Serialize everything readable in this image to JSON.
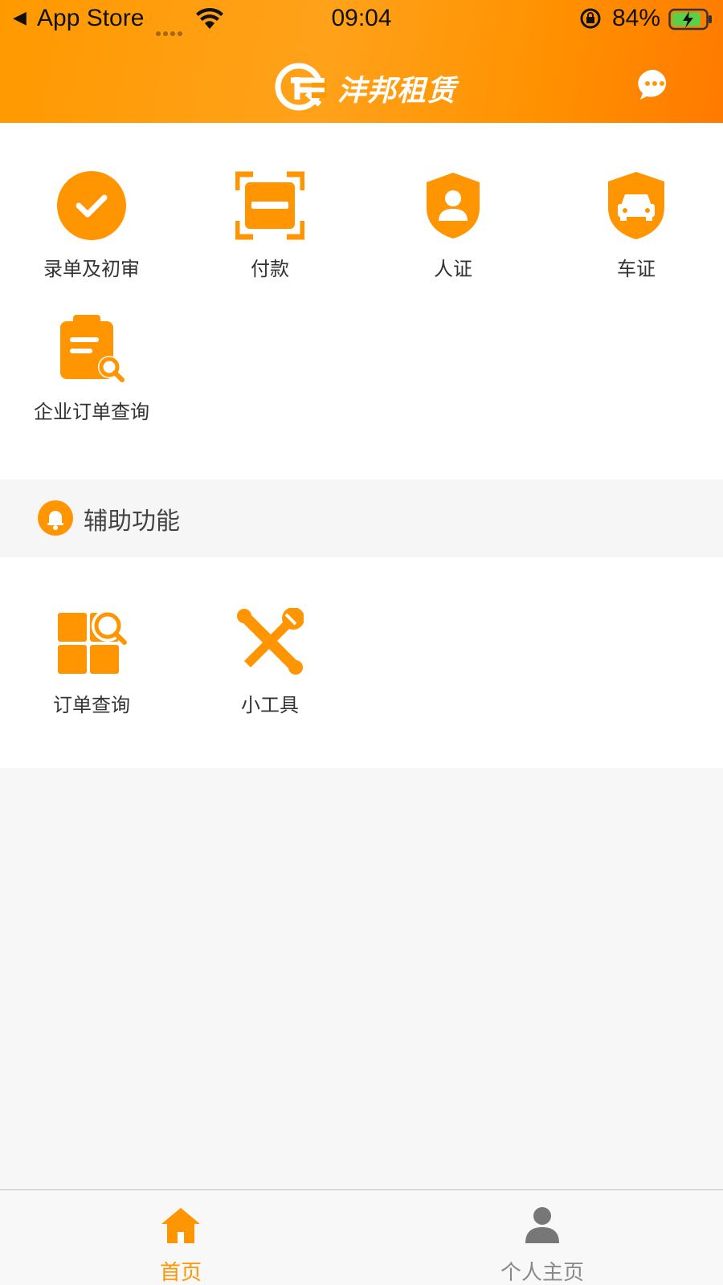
{
  "status_bar": {
    "back_label": "App Store",
    "time": "09:04",
    "battery_percent": "84%"
  },
  "header": {
    "app_name": "沣邦租赁"
  },
  "main_functions": [
    {
      "label": "录单及初审",
      "icon": "check-circle-icon"
    },
    {
      "label": "付款",
      "icon": "scan-frame-icon"
    },
    {
      "label": "人证",
      "icon": "person-shield-icon"
    },
    {
      "label": "车证",
      "icon": "car-shield-icon"
    },
    {
      "label": "企业订单查询",
      "icon": "clipboard-search-icon"
    }
  ],
  "aux_section": {
    "title": "辅助功能",
    "items": [
      {
        "label": "订单查询",
        "icon": "grid-search-icon"
      },
      {
        "label": "小工具",
        "icon": "tools-icon"
      }
    ]
  },
  "tabbar": {
    "tabs": [
      {
        "label": "首页",
        "icon": "home-icon",
        "active": true
      },
      {
        "label": "个人主页",
        "icon": "person-icon",
        "active": false
      }
    ]
  },
  "colors": {
    "accent": "#ff9500",
    "tab_active": "#ff9500",
    "tab_inactive": "#888888"
  }
}
